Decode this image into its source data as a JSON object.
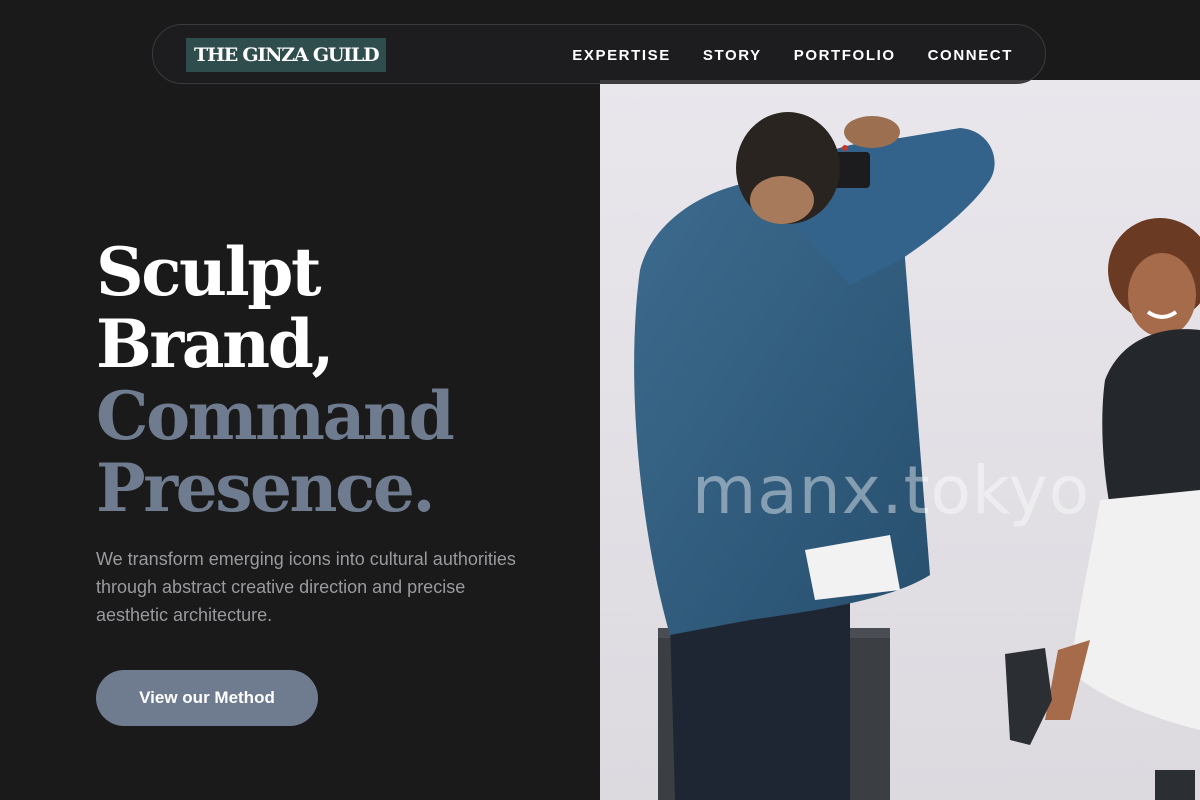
{
  "brand": {
    "logo_text": "THE GINZA GUILD"
  },
  "nav": {
    "links": [
      "EXPERTISE",
      "STORY",
      "PORTFOLIO",
      "CONNECT"
    ]
  },
  "hero": {
    "headline_line1": "Sculpt",
    "headline_line2": "Brand,",
    "headline_line3": "Command",
    "headline_line4": "Presence.",
    "subtext": "We transform emerging icons into cultural authorities through abstract creative direction and precise aesthetic architecture.",
    "cta_label": "View our Method"
  },
  "photo": {
    "watermark": "manx.tokyo",
    "subject": "photographer-and-model-photo"
  },
  "colors": {
    "background": "#1a1a1b",
    "accent": "#6f7c8f",
    "logo_bg": "#2f4d4c",
    "text_light": "#ffffff",
    "text_muted": "#9a9a9e"
  }
}
